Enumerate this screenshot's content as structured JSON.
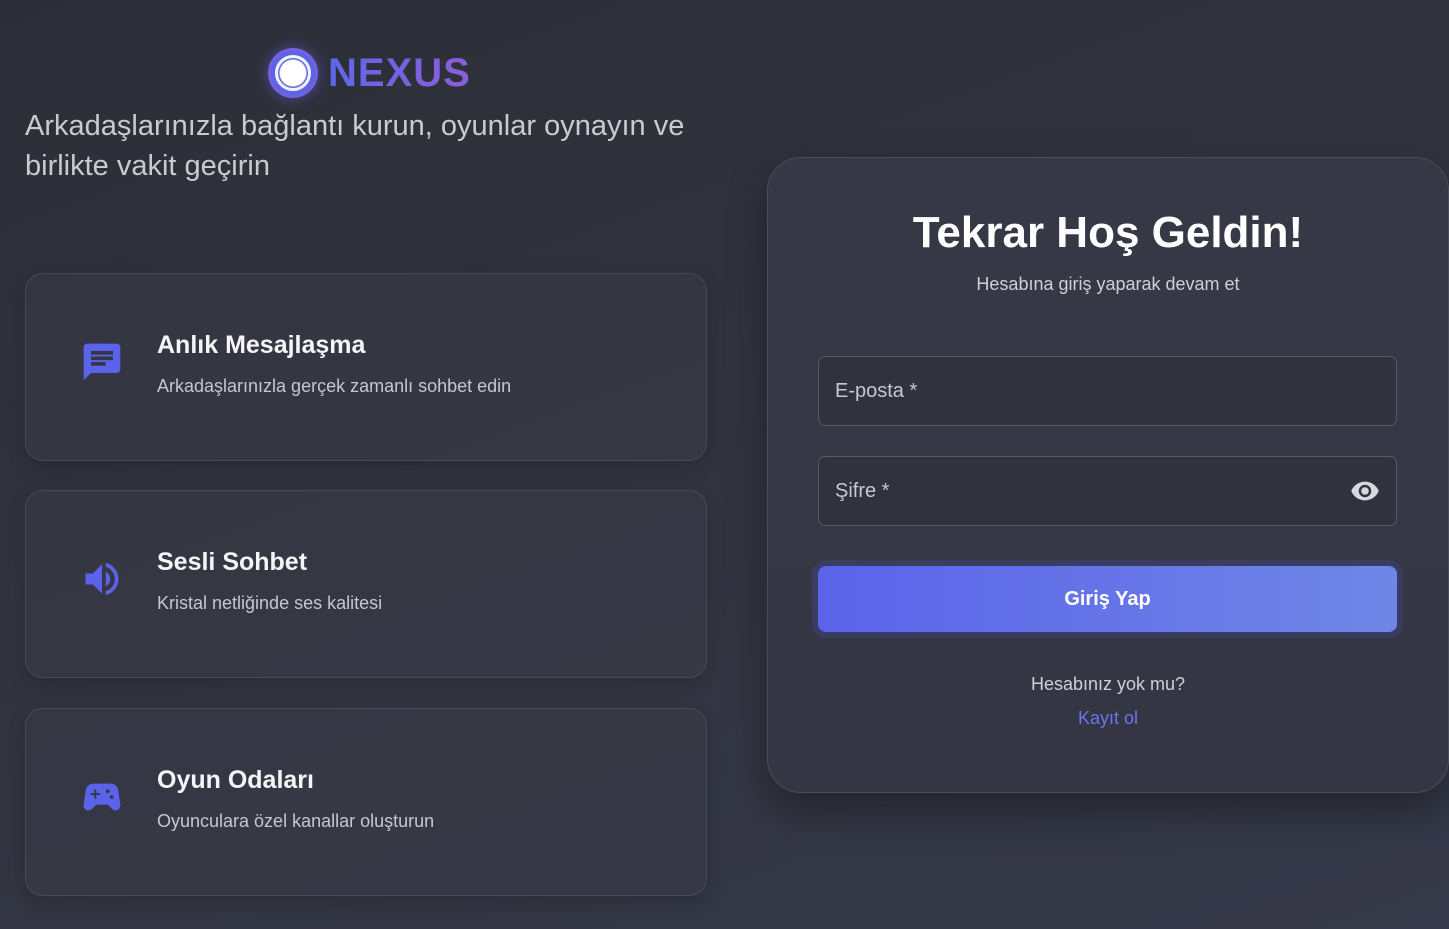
{
  "brand": {
    "name": "NEXUS",
    "tagline": "Arkadaşlarınızla bağlantı kurun, oyunlar oynayın ve birlikte vakit geçirin"
  },
  "features": [
    {
      "icon": "chat-message-icon",
      "title": "Anlık Mesajlaşma",
      "description": "Arkadaşlarınızla gerçek zamanlı sohbet edin"
    },
    {
      "icon": "speaker-volume-icon",
      "title": "Sesli Sohbet",
      "description": "Kristal netliğinde ses kalitesi"
    },
    {
      "icon": "gamepad-icon",
      "title": "Oyun Odaları",
      "description": "Oyunculara özel kanallar oluşturun"
    }
  ],
  "login": {
    "title": "Tekrar Hoş Geldin!",
    "subtitle": "Hesabına giriş yaparak devam et",
    "email_placeholder": "E-posta *",
    "password_placeholder": "Şifre *",
    "submit_label": "Giriş Yap",
    "no_account_text": "Hesabınız yok mu?",
    "register_label": "Kayıt ol"
  },
  "colors": {
    "accent": "#5b63ea",
    "accent_light": "#6f86e6",
    "link": "#6d73f2",
    "background": "#31333e",
    "card": "#363846"
  }
}
